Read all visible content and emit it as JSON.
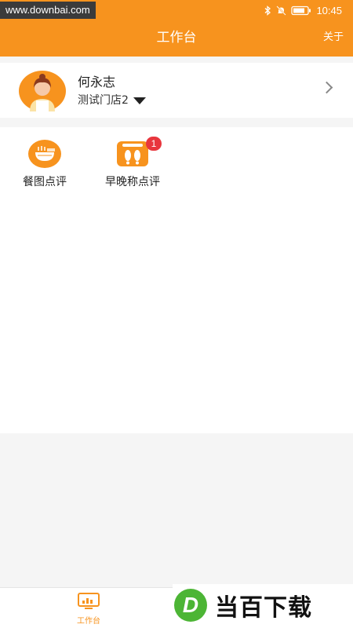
{
  "status_bar": {
    "watermark": "www.downbai.com",
    "time": "10:45"
  },
  "nav": {
    "title": "工作台",
    "about": "关于"
  },
  "profile": {
    "name": "何永志",
    "store": "测试门店2"
  },
  "grid": {
    "items": [
      {
        "label": "餐图点评",
        "icon": "noodle-bowl-icon"
      },
      {
        "label": "早晚称点评",
        "icon": "footprints-scale-icon",
        "badge": "1"
      }
    ]
  },
  "tabbar": {
    "tabs": [
      {
        "label": "工作台",
        "icon": "monitor-icon",
        "active": true
      },
      {
        "label": "",
        "icon": "tab-icon",
        "active": false
      }
    ]
  },
  "watermark_br": {
    "logo_letter": "D",
    "text": "当百下载"
  },
  "colors": {
    "primary": "#f7931e",
    "badge": "#e8363d",
    "logo_green": "#4cb535"
  }
}
